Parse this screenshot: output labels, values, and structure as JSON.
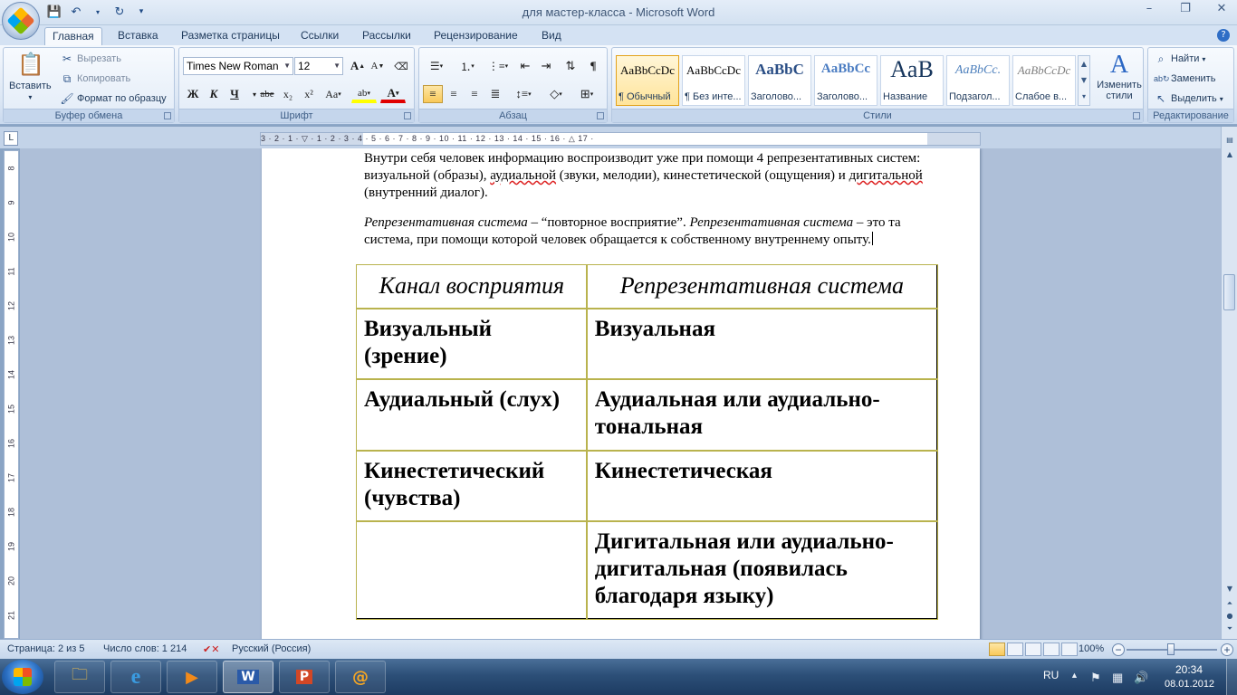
{
  "window": {
    "title": "для мастер-класса - Microsoft Word"
  },
  "quick_access": {
    "save": "save-icon",
    "undo": "undo-icon",
    "redo": "redo-icon",
    "customize": "▾"
  },
  "tabs": [
    "Главная",
    "Вставка",
    "Разметка страницы",
    "Ссылки",
    "Рассылки",
    "Рецензирование",
    "Вид"
  ],
  "ribbon": {
    "clipboard": {
      "label": "Буфер обмена",
      "paste": "Вставить",
      "cut": "Вырезать",
      "copy": "Копировать",
      "format_painter": "Формат по образцу"
    },
    "font": {
      "label": "Шрифт",
      "family": "Times New Roman",
      "size": "12",
      "grow": "A",
      "shrink": "A",
      "bold": "Ж",
      "italic": "К",
      "underline": "Ч",
      "strike": "abe",
      "sub": "x₂",
      "sup": "x²",
      "case": "Aa",
      "highlight": "ab",
      "color": "A"
    },
    "paragraph": {
      "label": "Абзац",
      "pilcrow": "¶"
    },
    "styles": {
      "label": "Стили",
      "items": [
        {
          "sample": "AaBbCcDc",
          "name": "¶ Обычный"
        },
        {
          "sample": "AaBbCcDc",
          "name": "¶ Без инте..."
        },
        {
          "sample": "AaBbC",
          "name": "Заголово..."
        },
        {
          "sample": "AaBbCc",
          "name": "Заголово..."
        },
        {
          "sample": "AaB",
          "name": "Название"
        },
        {
          "sample": "AaBbCc.",
          "name": "Подзагол..."
        },
        {
          "sample": "AaBbCcDc",
          "name": "Слабое в..."
        }
      ],
      "change_styles": "Изменить стили"
    },
    "editing": {
      "label": "Редактирование",
      "find": "Найти",
      "replace": "Заменить",
      "select": "Выделить"
    }
  },
  "ruler": {
    "h_ticks": "3 · 2 · 1 · ▽ · 1 · 2 · 3 · 4 · 5 · 6 · 7 · 8 · 9 · 10 · 11 · 12 · 13 · 14 · 15 · 16 · △ 17 ·",
    "v_ticks": [
      "8",
      "9",
      "10",
      "11",
      "12",
      "13",
      "14",
      "15",
      "16",
      "17",
      "18",
      "19",
      "20",
      "21"
    ]
  },
  "document": {
    "p1_a": "Внутри себя человек информацию воспроизводит уже при помощи 4 репрезентативных систем: визуальной (образы), ",
    "p1_aud": "аудиальной",
    "p1_b": " (звуки, мелодии), кинестетической (ощущения) и ",
    "p1_dig": "дигитальной",
    "p1_c": " (внутренний диалог).",
    "p2_term1": "Репрезентативная система",
    "p2_a": " – “повторное восприятие”. ",
    "p2_term2": "Репрезентативная система",
    "p2_b": " – это та система, при помощи которой человек обращается к собственному внутреннему опыту.",
    "table": {
      "headers": [
        "Канал восприятия",
        "Репрезентативная система"
      ],
      "rows": [
        [
          "Визуальный (зрение)",
          "Визуальная"
        ],
        [
          "Аудиальный (слух)",
          "Аудиальная или аудиально-тональная"
        ],
        [
          "Кинестетический (чувства)",
          "Кинестетическая"
        ],
        [
          "",
          "Дигитальная или аудиально-дигитальная (появилась благодаря языку)"
        ]
      ]
    }
  },
  "status": {
    "page": "Страница: 2 из 5",
    "words": "Число слов: 1 214",
    "language": "Русский (Россия)",
    "zoom": "100%"
  },
  "taskbar": {
    "lang": "RU",
    "time": "20:34",
    "date": "08.01.2012"
  }
}
